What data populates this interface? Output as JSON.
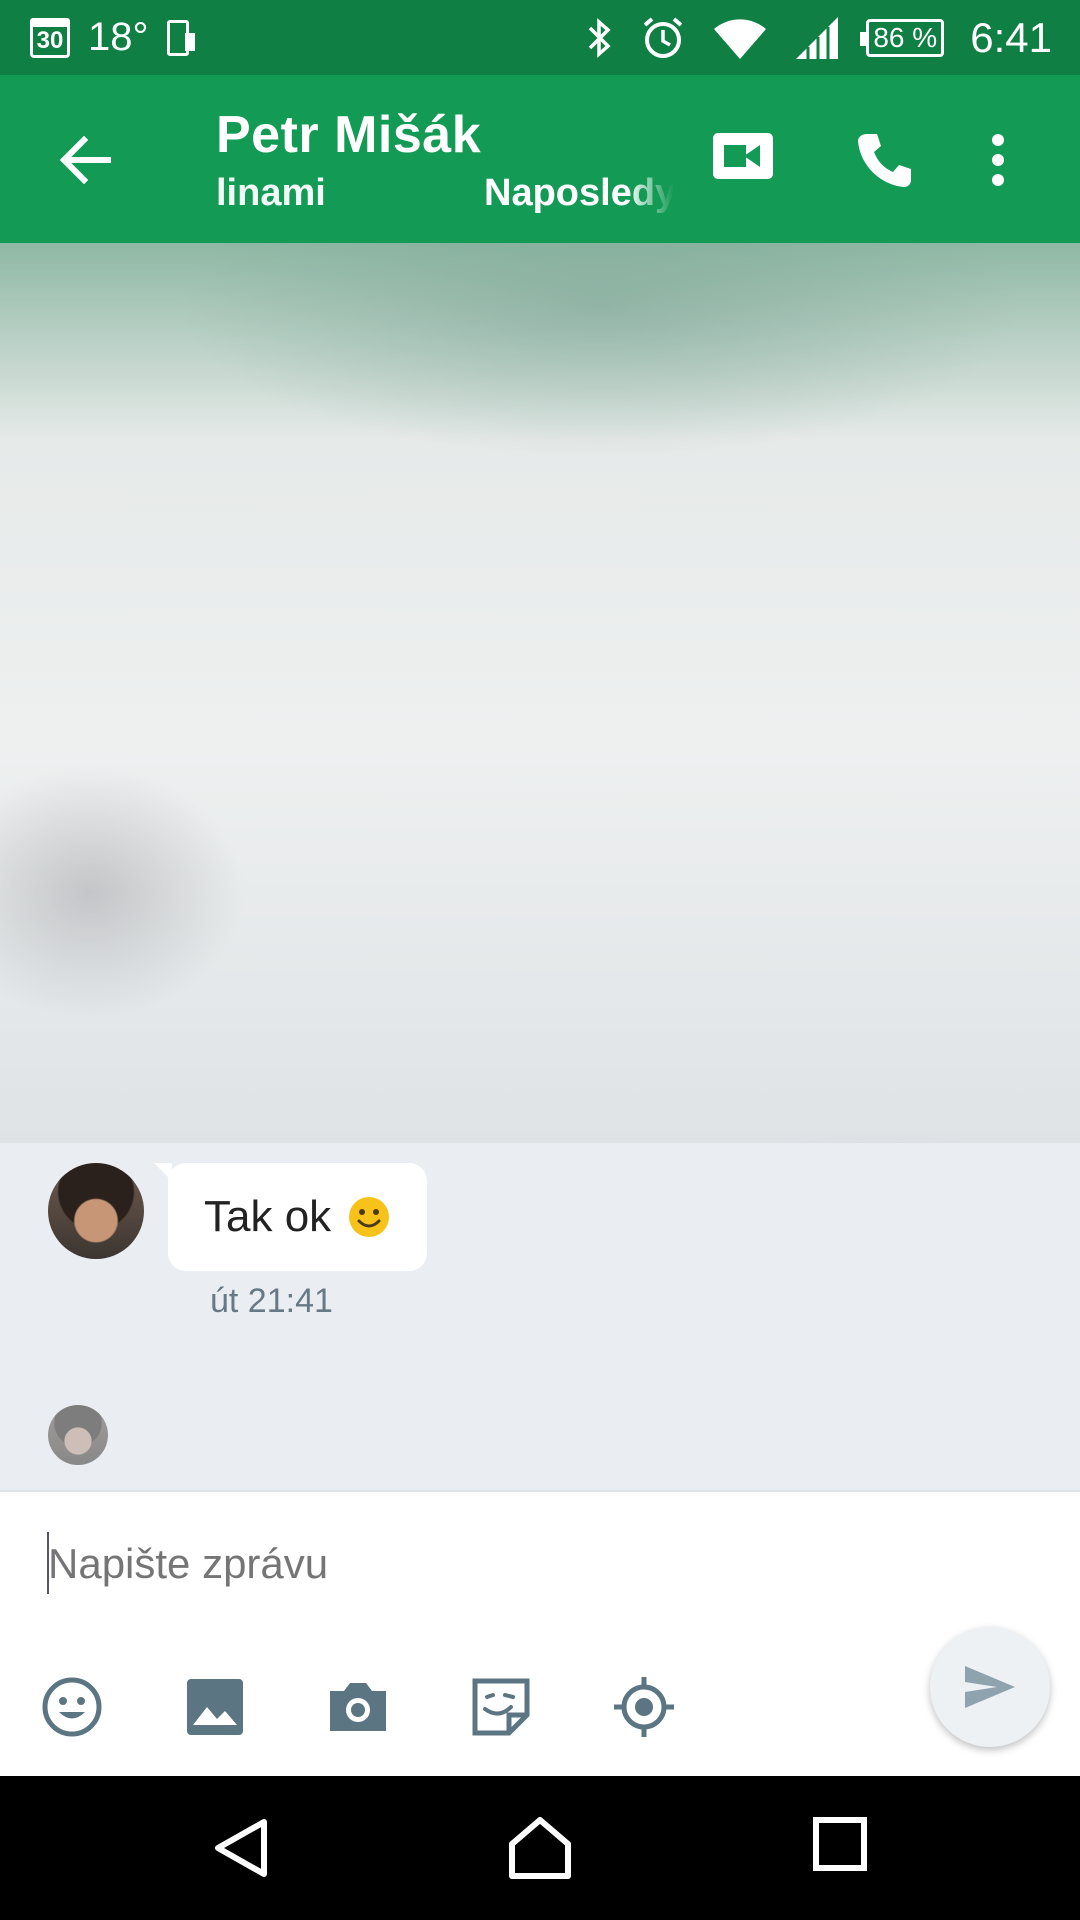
{
  "status_bar": {
    "calendar_day": "30",
    "temperature": "18°",
    "battery": "86 %",
    "time": "6:41",
    "icons": [
      "calendar-icon",
      "phone-status-icon",
      "bluetooth-icon",
      "alarm-icon",
      "wifi-icon",
      "signal-icon",
      "battery-icon"
    ]
  },
  "header": {
    "title": "Petr Mišák",
    "subtitle_scroll_left": "linami",
    "subtitle_scroll_right": "Naposledy",
    "icons": [
      "back-arrow-icon",
      "video-call-icon",
      "phone-call-icon",
      "more-vert-icon"
    ]
  },
  "conversation": {
    "messages": [
      {
        "text": "Tak ok",
        "emoji": "slightly-smiling-face",
        "timestamp": "út 21:41"
      }
    ]
  },
  "composer": {
    "placeholder": "Napište zprávu",
    "tools": [
      "emoji-icon",
      "gallery-icon",
      "camera-icon",
      "sticker-icon",
      "location-icon"
    ],
    "send_icon": "send-icon"
  },
  "colors": {
    "status_bar": "#0f7f43",
    "app_bar": "#139a55",
    "tool_icons": "#5c7582",
    "send_icon": "#8fa3ae"
  },
  "nav_bar": {
    "icons": [
      "back-nav-icon",
      "home-nav-icon",
      "recents-nav-icon"
    ]
  }
}
